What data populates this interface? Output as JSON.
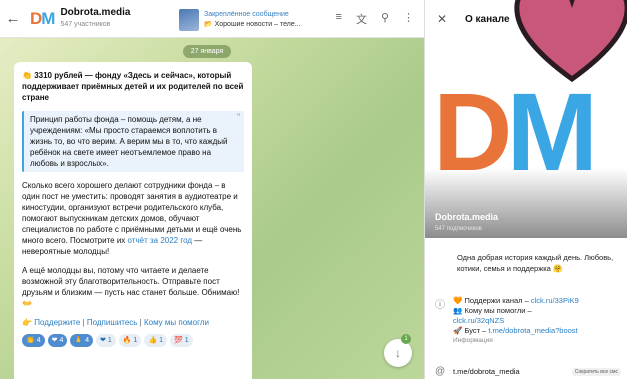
{
  "header": {
    "back_icon": "arrow-left-icon",
    "logo_d": "D",
    "logo_m": "M",
    "channel_name": "Dobrota.media",
    "members": "547 участников",
    "pinned_label": "Закреплённое сообщение",
    "pinned_preview": "Хорошие новости – теле...",
    "icons": [
      "voice-chat-icon",
      "translate-icon",
      "search-icon",
      "more-icon"
    ]
  },
  "chat": {
    "date": "27 января",
    "title": "3310 рублей — фонду «Здесь и сейчас», который поддерживает приёмных детей и их родителей по всей стране",
    "quote": "Принцип работы фонда – помощь детям, а не учреждениям: «Мы просто стараемся воплотить в жизнь то, во что верим. А верим мы в то, что каждый ребёнок на свете имеет неотъемлемое право на любовь и взрослых».",
    "p1": "Сколько всего хорошего делают сотрудники фонда – в один пост не уместить: проводят занятия в аудиотеатре и киностудии, организуют встречи родительского клуба, помогают выпускникам детских домов, обучают специалистов по работе с приёмными детьми и ещё очень много всего. Посмотрите их",
    "p1_link": "отчёт за 2022 год",
    "p1_end": " — невероятные молодцы!",
    "p2": "А ещё молодцы вы, потому что читаете и делаете возможной эту благотворительность. Отправьте пост друзьям и близким — пусть нас станет больше. Обнимаю!",
    "links": [
      "Поддержите",
      "Подпишитесь",
      "Кому мы помогли"
    ],
    "reactions": [
      {
        "icon": "clap-icon",
        "count": "4",
        "active": true
      },
      {
        "icon": "heart-icon",
        "count": "4",
        "active": true
      },
      {
        "icon": "pray-icon",
        "count": "4",
        "active": true
      },
      {
        "icon": "heart-icon",
        "count": "1",
        "active": false
      },
      {
        "icon": "fire-icon",
        "count": "1",
        "active": false
      },
      {
        "icon": "thumbs-up-icon",
        "count": "1",
        "active": false
      },
      {
        "icon": "hundred-icon",
        "count": "1",
        "active": false
      }
    ],
    "scroll_badge": "1"
  },
  "panel": {
    "title": "О канале",
    "cover_name": "Dobrota.media",
    "cover_subs": "547 подписчиков",
    "description": "Одна добрая история каждый день. Любовь, котики, семья и поддержка",
    "info_line1": "Поддержи канал –",
    "info_link1": "clck.ru/33PiK9",
    "info_line2": "Кому мы помогли –",
    "info_link2": "clck.ru/32qNZS",
    "info_line3": "Буст –",
    "info_link3": "t.me/dobrota_media?boost",
    "info_sub": "Информация",
    "link": "t.me/dobrota_media",
    "toast": "Сократить все смс"
  },
  "colors": {
    "accent": "#3ba6e4",
    "orange": "#e8743a",
    "heart": "#c9577a"
  }
}
